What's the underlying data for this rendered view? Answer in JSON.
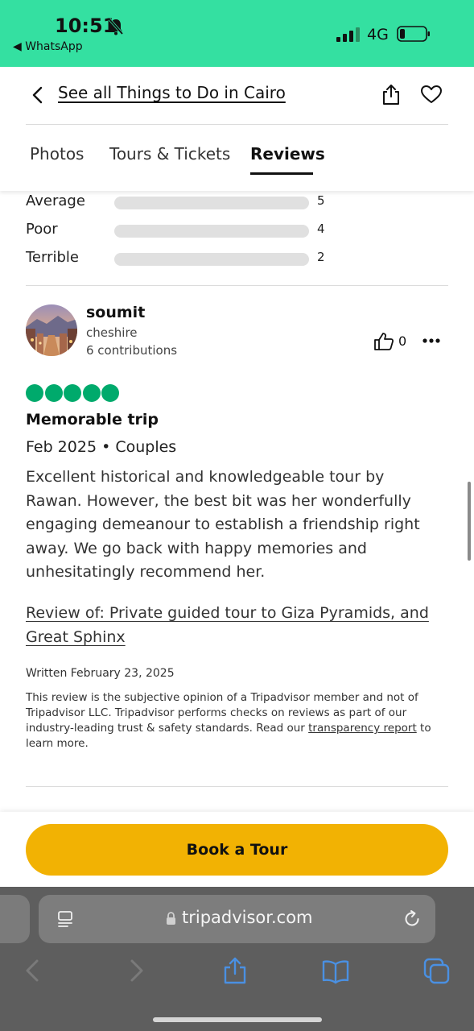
{
  "status_bar": {
    "time": "10:51",
    "back_app": "◀ WhatsApp",
    "network": "4G",
    "bg_color": "#34e0a1"
  },
  "header": {
    "back_link": "See all Things to Do in Cairo",
    "tabs": [
      {
        "label": "Photos",
        "active": false
      },
      {
        "label": "Tours & Tickets",
        "active": false
      },
      {
        "label": "Reviews",
        "active": true
      }
    ]
  },
  "ratings": [
    {
      "label": "Average",
      "count": "5"
    },
    {
      "label": "Poor",
      "count": "4"
    },
    {
      "label": "Terrible",
      "count": "2"
    }
  ],
  "review": {
    "user": {
      "name": "soumit",
      "location": "cheshire",
      "contributions": "6 contributions"
    },
    "helpful_count": "0",
    "bubble_rating": 5,
    "title": "Memorable trip",
    "meta": "Feb 2025 • Couples",
    "text": "Excellent historical and knowledgeable tour by Rawan. However, the best bit was her wonderfully engaging demeanour to establish a friendship right away. We go back with happy memories and unhesitatingly recommend her.",
    "review_of": "Review of: Private guided tour to Giza Pyramids, and Great Sphinx",
    "written": "Written February 23, 2025",
    "disclaimer": {
      "text_before": "This review is the subjective opinion of a Tripadvisor member and not of Tripadvisor LLC. Tripadvisor performs checks on reviews as part of our industry-leading trust & safety standards. Read our ",
      "link": "transparency report",
      "text_after": " to learn more."
    }
  },
  "cta": {
    "book_label": "Book a Tour",
    "color": "#f2b203"
  },
  "browser": {
    "url": "tripadvisor.com",
    "accent_color": "#4a90e2"
  },
  "icons": [
    "bell-slash-icon",
    "signal-icon",
    "battery-icon",
    "chevron-left-icon",
    "share-icon",
    "heart-icon",
    "thumbs-up-icon",
    "more-icon",
    "reader-icon",
    "lock-icon",
    "reload-icon",
    "back-icon",
    "forward-icon",
    "share-icon",
    "bookmarks-icon",
    "tabs-icon"
  ]
}
